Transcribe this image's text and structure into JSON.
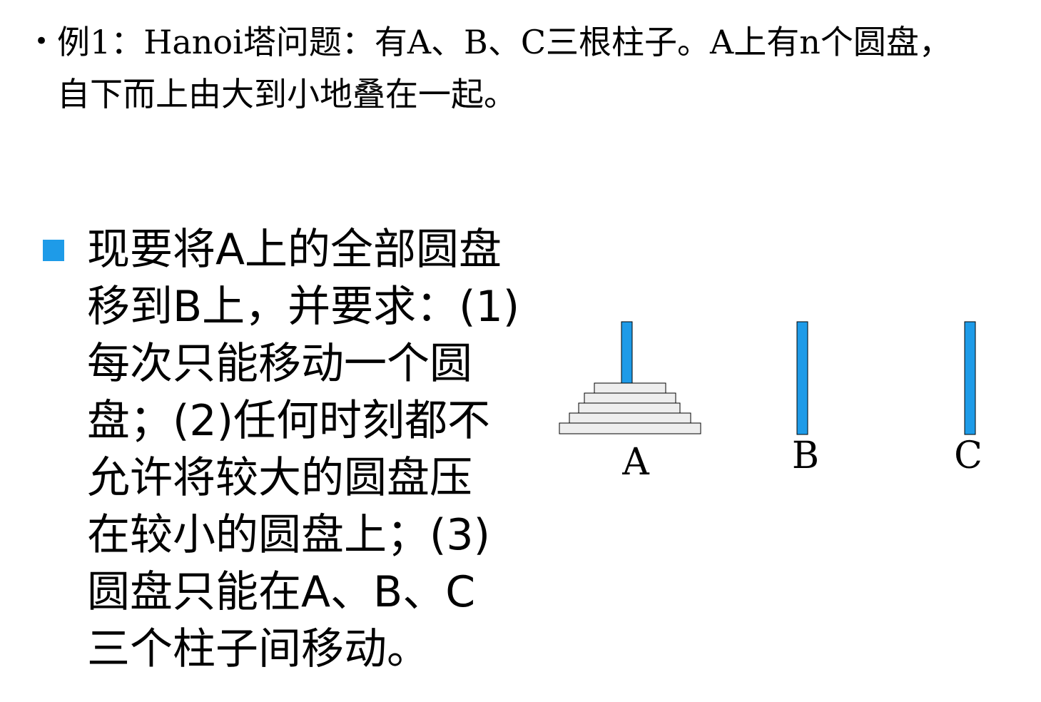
{
  "intro": {
    "bullet": "•",
    "line1": "例1：Hanoi塔问题：有A、B、C三根柱子。A上有n个圆盘，",
    "line2": "自下而上由大到小地叠在一起。"
  },
  "rule": {
    "lines": [
      "现要将A上的全部圆盘",
      "移到B上，并要求：(1)",
      "每次只能移动一个圆",
      "盘；(2)任何时刻都不",
      "允许将较大的圆盘压",
      "在较小的圆盘上；(3)",
      "圆盘只能在A、B、C",
      "三个柱子间移动。"
    ]
  },
  "diagram": {
    "peg_color": "#1e9be8",
    "disk_fill": "#eeeeee",
    "disk_count": 5,
    "labels": {
      "a": "A",
      "b": "B",
      "c": "C"
    }
  }
}
